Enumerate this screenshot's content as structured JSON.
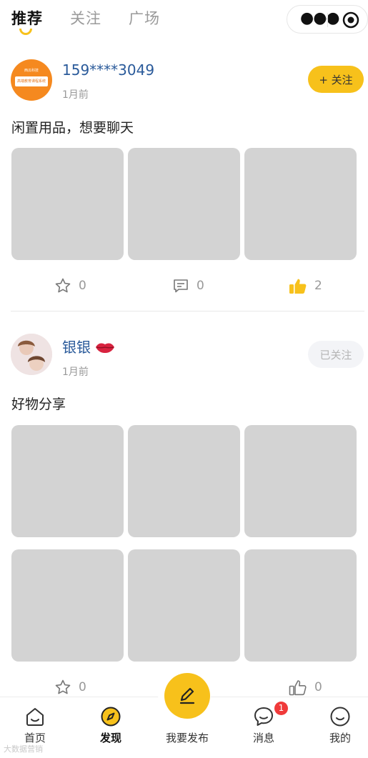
{
  "top_tabs": [
    {
      "label": "推荐",
      "active": true
    },
    {
      "label": "关注",
      "active": false
    },
    {
      "label": "广场",
      "active": false
    }
  ],
  "capsule": {
    "more_icon": "more-dots-icon",
    "close_icon": "target-circle-icon"
  },
  "posts": [
    {
      "username": "159****3049",
      "time": "1月前",
      "follow_label": "+ 关注",
      "text": "闲置用品，想要聊天",
      "avatar_lines": [
        "西瓜科技",
        "高端教育课程系统"
      ],
      "stats": {
        "favorites": "0",
        "comments": "0",
        "likes": "2"
      }
    },
    {
      "username": "银银",
      "time": "1月前",
      "follow_label": "已关注",
      "text": "好物分享",
      "stats": {
        "favorites": "0",
        "likes": "0"
      }
    }
  ],
  "tabbar": {
    "home": "首页",
    "discover": "发现",
    "publish": "我要发布",
    "messages": "消息",
    "messages_badge": "1",
    "mine": "我的"
  },
  "colors": {
    "accent": "#f7c11b",
    "link": "#2a5a9a",
    "image_placeholder": "#d3d3d3",
    "badge": "#f03a3a"
  },
  "watermark": "大数据营销"
}
